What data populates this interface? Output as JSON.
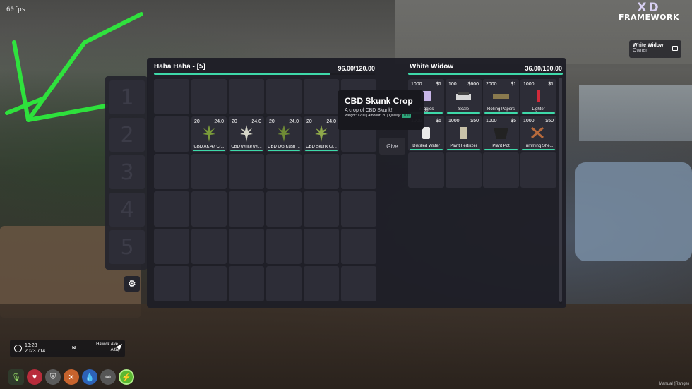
{
  "hud": {
    "fps": "60fps",
    "time": "13:28",
    "date": "2023.714",
    "heading": "N",
    "street": "Hawick Ave",
    "area": "Alta",
    "corner_hint": "Manual (Range)"
  },
  "brand": {
    "logo_top": "XD",
    "logo_bottom": "FRAMEWORK"
  },
  "job": {
    "title": "White Widow",
    "role": "Owner"
  },
  "hotbar": {
    "slots": [
      "1",
      "2",
      "3",
      "4",
      "5"
    ]
  },
  "player_inventory": {
    "title": "Haha Haha - [5]",
    "weight": "96.00/120.00",
    "weight_fraction": 0.8,
    "rows": [
      [
        {
          "amount": "",
          "weight": "",
          "label": ""
        },
        {
          "amount": "",
          "weight": "",
          "label": ""
        },
        {
          "amount": "",
          "weight": "",
          "label": ""
        },
        {
          "amount": "",
          "weight": "",
          "label": ""
        },
        {
          "amount": "",
          "weight": "",
          "label": ""
        },
        {
          "amount": "",
          "weight": "",
          "label": ""
        }
      ],
      [
        {
          "amount": "",
          "weight": "",
          "label": ""
        },
        {
          "amount": "20",
          "weight": "24.0",
          "label": "CBD AK 47 Cr..."
        },
        {
          "amount": "20",
          "weight": "24.0",
          "label": "CBD White Wi..."
        },
        {
          "amount": "20",
          "weight": "24.0",
          "label": "CBD OG Kush ..."
        },
        {
          "amount": "20",
          "weight": "24.0",
          "label": "CBD Skunk Cr..."
        },
        {
          "amount": "",
          "weight": "",
          "label": ""
        }
      ]
    ]
  },
  "shop": {
    "title": "White Widow",
    "weight": "36.00/100.00",
    "weight_fraction": 0.36,
    "items": [
      {
        "amount": "1000",
        "price": "$1",
        "label": "Baggies"
      },
      {
        "amount": "100",
        "price": "$600",
        "label": "Scale"
      },
      {
        "amount": "2000",
        "price": "$1",
        "label": "Rolling Papers"
      },
      {
        "amount": "1000",
        "price": "$1",
        "label": "Lighter"
      },
      {
        "amount": "1000",
        "price": "$5",
        "label": "Distilled Water"
      },
      {
        "amount": "1000",
        "price": "$50",
        "label": "Plant Fertilizer"
      },
      {
        "amount": "1000",
        "price": "$5",
        "label": "Plant Pot"
      },
      {
        "amount": "1000",
        "price": "$50",
        "label": "Trimming She..."
      }
    ]
  },
  "middle": {
    "give_label": "Give"
  },
  "tooltip": {
    "title": "CBD Skunk Crop",
    "description": "A crop of CBD Skunk!",
    "meta": "Weight: 1200 | Amount: 20 | Quality:",
    "quality_tag": "100"
  },
  "colors": {
    "accent": "#3ed9a9",
    "panel": "#1e1e26",
    "slot": "#2d2d37"
  }
}
